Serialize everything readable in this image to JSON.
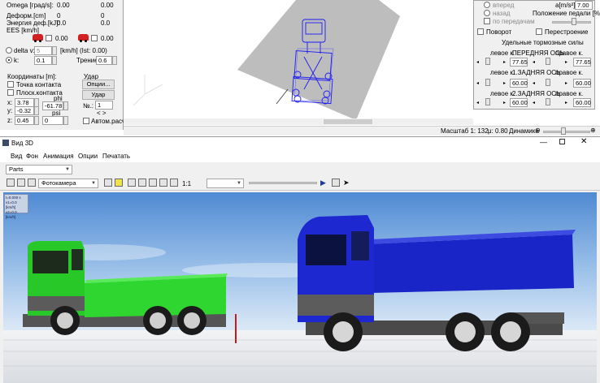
{
  "top_panel": {
    "omega_label": "Omega [град/s]:",
    "omega_a": "0.00",
    "omega_b": "0.00",
    "deform_label": "Деформ.[cm]",
    "deform_a": "0",
    "deform_b": "0",
    "energy_label": "Энергия деф.[kJ]:",
    "energy_a": "0.0",
    "energy_b": "0.0",
    "ees_label": "EES [km/h]",
    "car_a_value": "0.00",
    "car_b_value": "0.00",
    "delta_v_label": "delta v:",
    "delta_v_value": "5",
    "delta_v_unit": "[km/h] (Ist: 0.00)",
    "k_label": "k:",
    "k_value": "0.1",
    "friction_label": "Трение:",
    "friction_value": "0.6",
    "coords_label": "Координаты [m]:",
    "contact_point_label": "Точка контакта",
    "contact_plane_label": "Плоск.контакта",
    "x_label": "x:",
    "x_value": "3.78",
    "y_label": "y:",
    "y_value": "-0.32",
    "z_label": "z:",
    "z_value": "0.45",
    "phi_label": "phi",
    "phi_value": "-61.78",
    "psi_label": "psi",
    "psi_value": "0",
    "impact_label": "Удар",
    "options_button": "Опции...",
    "impact_button": "Удар",
    "number_label": "№.:",
    "number_value": "1",
    "prev_next": "<   >",
    "auto_calc_label": "Автом.расч"
  },
  "right_panel": {
    "forward_label": "вперед",
    "back_label": "назад",
    "gears_label": "по передачам",
    "accel_label": "a[m/s²]",
    "accel_value": "7.00",
    "pedal_label": "Положение педали [%]",
    "turn_label": "Поворот",
    "rebuild_label": "Перестроение",
    "brake_title": "Удельные тормозные силы",
    "front_left_label": "левое к.",
    "front_axle_label": "ПЕРЕДНЯЯ ОСЬ",
    "front_right_label": "правое к.",
    "front_left_value": "77.65",
    "front_right_value": "77.65",
    "rear1_left_label": "левое к.",
    "rear1_axle_label": "1.ЗАДНЯЯ ОСЬ",
    "rear1_right_label": "правое к.",
    "rear1_left_value": "60.00",
    "rear1_right_value": "60.00",
    "rear2_left_label": "левое к.",
    "rear2_axle_label": "2.ЗАДНЯЯ ОСЬ",
    "rear2_right_label": "правое к.",
    "rear2_left_value": "60.00",
    "rear2_right_value": "60.00"
  },
  "status_bar": {
    "scale": "Масштаб 1: 132",
    "mu": "μ: 0.80",
    "dynamics": "Динамика"
  },
  "window3d": {
    "title": "Вид 3D",
    "menu": [
      "Вид",
      "Фон",
      "Анимация",
      "Опции",
      "Печатать"
    ],
    "parts_combo": "Parts",
    "camera_combo": "Фотокамера",
    "zoom_value": "1:1",
    "hud_lines": [
      "t=0.000 s",
      "v1=0.0 [km/h]",
      "v2=0.0 [km/h]"
    ]
  },
  "colors": {
    "truck_green": "#2fd62f",
    "truck_blue": "#1a25c8",
    "sky_top": "#5b94d6",
    "ground": "#e9ecef",
    "marker_red": "#c61b1b"
  }
}
